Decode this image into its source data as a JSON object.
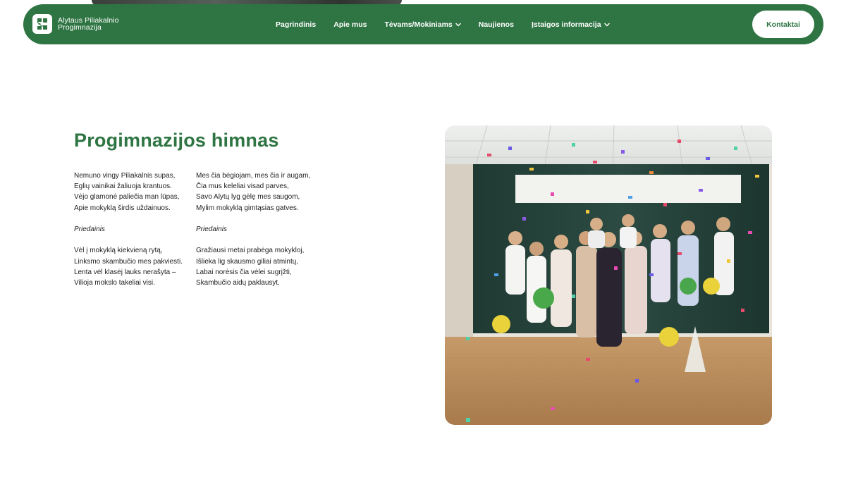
{
  "nav": {
    "brand_line1": "Alytaus Piliakalnio",
    "brand_line2": "Progimnazija",
    "items": [
      {
        "label": "Pagrindinis",
        "dropdown": false
      },
      {
        "label": "Apie mus",
        "dropdown": false
      },
      {
        "label": "Tėvams/Mokiniams",
        "dropdown": true
      },
      {
        "label": "Naujienos",
        "dropdown": false
      },
      {
        "label": "Įstaigos informacija",
        "dropdown": true
      }
    ],
    "cta_label": "Kontaktai"
  },
  "anthem": {
    "title": "Progimnazijos himnas",
    "col1": {
      "verse1": [
        "Nemuno vingy Piliakalnis supas,",
        "Eglių vainikai žaliuoja krantuos.",
        "Vėjo glamonė paliečia man lūpas,",
        "Apie mokyklą širdis uždainuos."
      ],
      "refrain_label": "Priedainis",
      "verse2": [
        "Vėl į mokyklą kiekvieną rytą,",
        "Linksmo skambučio mes pakviesti.",
        "Lenta vėl klasėj lauks nerašyta –",
        "Vilioja mokslo takeliai visi."
      ]
    },
    "col2": {
      "verse1": [
        "Mes čia bėgiojam, mes čia ir augam,",
        "Čia mus keleliai visad parves,",
        "Savo Alytų lyg gėlę mes saugom,",
        "Mylim mokyklą gimtąsias gatves."
      ],
      "refrain_label": "Priedainis",
      "verse2": [
        "Gražiausi metai prabėga mokykloj,",
        "Išlieka lig skausmo giliai atmintų,",
        "Labai norėsis čia vėlei sugrįžti,",
        "Skambučio aidų paklausyt."
      ]
    }
  },
  "colors": {
    "brand_green": "#2f7543",
    "white": "#ffffff",
    "text": "#1f1f1f"
  },
  "icons": {
    "logo": "school-logo-icon",
    "dropdown": "chevron-down-icon"
  }
}
